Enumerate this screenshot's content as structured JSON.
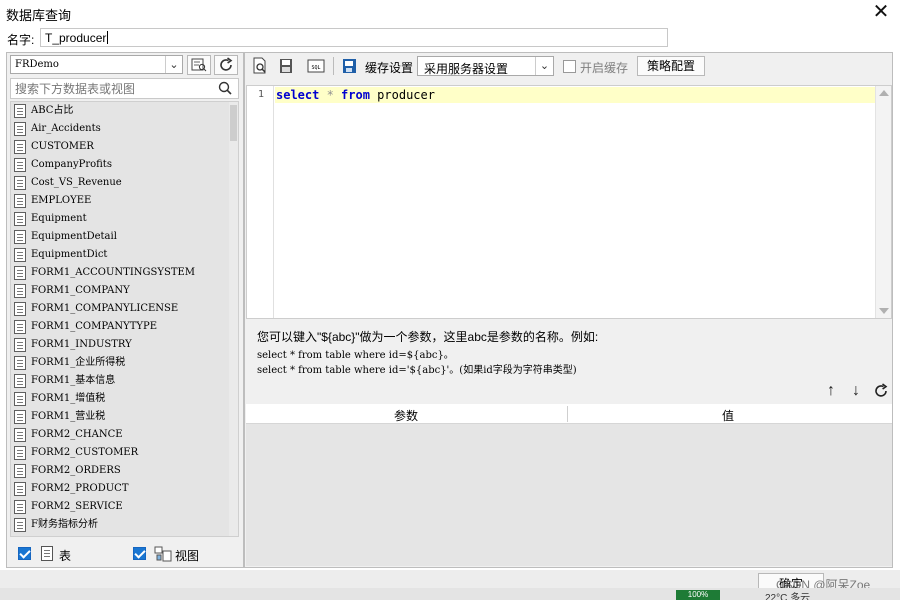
{
  "window": {
    "title": "数据库查询",
    "close_glyph": "✕"
  },
  "name": {
    "label": "名字:",
    "value": "T_producer"
  },
  "left": {
    "database": "FRDemo",
    "search_placeholder": "搜索下方数据表或视图",
    "tables": [
      "ABC占比",
      "Air_Accidents",
      "CUSTOMER",
      "CompanyProfits",
      "Cost_VS_Revenue",
      "EMPLOYEE",
      "Equipment",
      "EquipmentDetail",
      "EquipmentDict",
      "FORM1_ACCOUNTINGSYSTEM",
      "FORM1_COMPANY",
      "FORM1_COMPANYLICENSE",
      "FORM1_COMPANYTYPE",
      "FORM1_INDUSTRY",
      "FORM1_企业所得税",
      "FORM1_基本信息",
      "FORM1_增值税",
      "FORM1_营业税",
      "FORM2_CHANCE",
      "FORM2_CUSTOMER",
      "FORM2_ORDERS",
      "FORM2_PRODUCT",
      "FORM2_SERVICE",
      "F财务指标分析"
    ],
    "footer": {
      "table_label": "表",
      "view_label": "视图"
    }
  },
  "toolbar": {
    "cache_label": "缓存设置",
    "cache_mode": "采用服务器设置",
    "enable_cache_label": "开启缓存",
    "strategy_label": "策略配置"
  },
  "editor": {
    "line_number": "1",
    "tokens": {
      "kw1": "select",
      "star": " * ",
      "kw2": "from",
      "rest": " producer"
    }
  },
  "hint": {
    "line1": "您可以键入\"${abc}\"做为一个参数，这里abc是参数的名称。例如:",
    "line2": "select * from table where id=${abc}。",
    "line3": "select * from table where id='${abc}'。(如果id字段为字符串类型)"
  },
  "params": {
    "col_param": "参数",
    "col_value": "值"
  },
  "statusbar": {
    "ok_label": "确定",
    "watermark": "CSDN @阿呆Zoe",
    "battery": "100%",
    "weather": "22°C 多云"
  }
}
